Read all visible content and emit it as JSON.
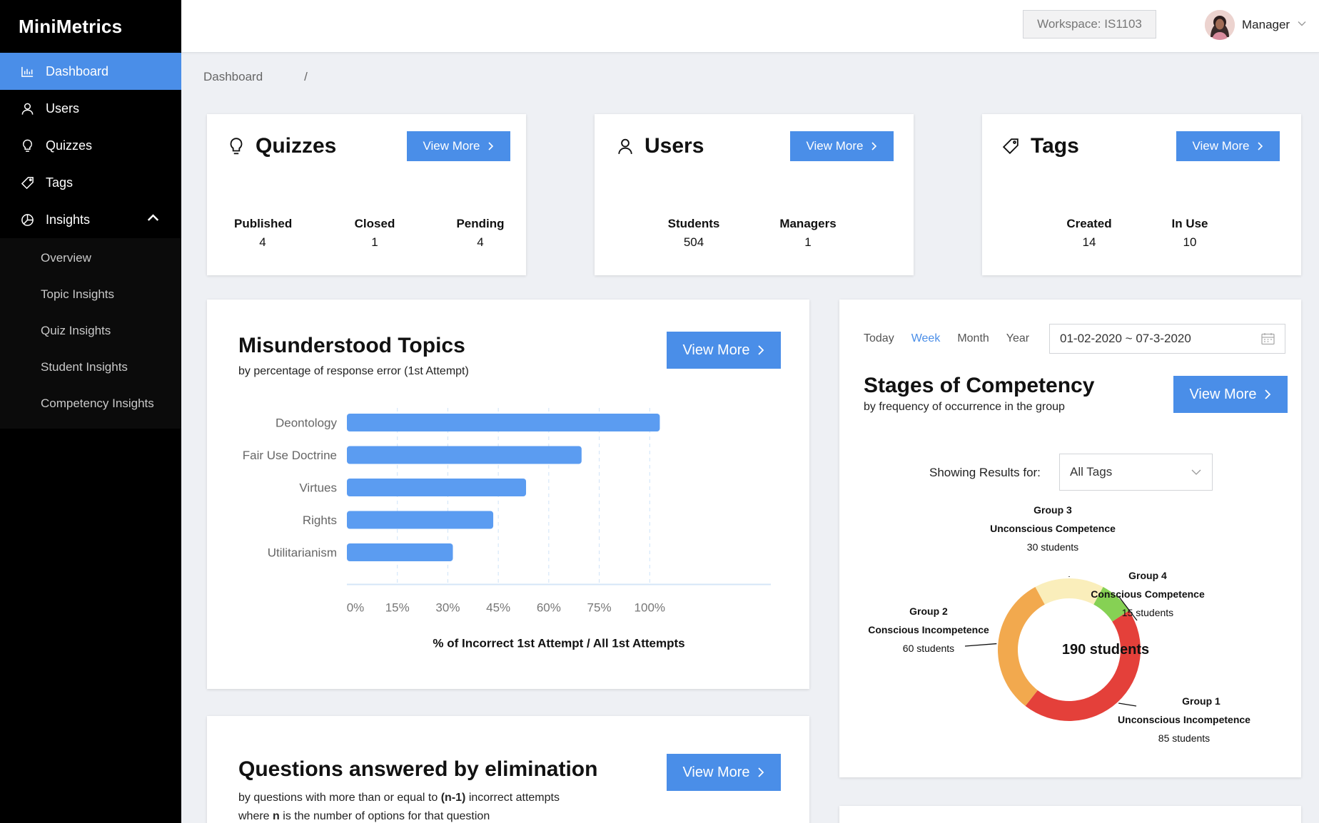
{
  "app": {
    "name": "MiniMetrics"
  },
  "sidebar": {
    "items": [
      {
        "label": "Dashboard",
        "icon": "bar-chart-icon",
        "active": true
      },
      {
        "label": "Users",
        "icon": "user-icon"
      },
      {
        "label": "Quizzes",
        "icon": "lightbulb-icon"
      },
      {
        "label": "Tags",
        "icon": "tag-icon"
      },
      {
        "label": "Insights",
        "icon": "pie-chart-icon",
        "expanded": true
      }
    ],
    "insights_sub": [
      "Overview",
      "Topic Insights",
      "Quiz Insights",
      "Student Insights",
      "Competency Insights"
    ]
  },
  "header": {
    "workspace": "Workspace: IS1103",
    "user_role": "Manager"
  },
  "breadcrumb": {
    "current": "Dashboard",
    "separator": "/"
  },
  "common": {
    "view_more": "View More"
  },
  "quizzes_card": {
    "title": "Quizzes",
    "stats": [
      {
        "label": "Published",
        "value": "4"
      },
      {
        "label": "Closed",
        "value": "1"
      },
      {
        "label": "Pending",
        "value": "4"
      }
    ]
  },
  "users_card": {
    "title": "Users",
    "stats": [
      {
        "label": "Students",
        "value": "504"
      },
      {
        "label": "Managers",
        "value": "1"
      }
    ]
  },
  "tags_card": {
    "title": "Tags",
    "stats": [
      {
        "label": "Created",
        "value": "14"
      },
      {
        "label": "In Use",
        "value": "10"
      }
    ]
  },
  "misunderstood": {
    "title": "Misunderstood Topics",
    "subtitle": "by percentage of response error (1st Attempt)"
  },
  "competency": {
    "range_tabs": [
      "Today",
      "Week",
      "Month",
      "Year"
    ],
    "active_range": "Week",
    "date_range": "01-02-2020 ~ 07-3-2020",
    "title": "Stages of Competency",
    "subtitle": "by frequency of occurrence in the group",
    "filter_label": "Showing Results for:",
    "filter_value": "All Tags",
    "center_label": "190 students"
  },
  "elimination": {
    "title": "Questions answered by elimination",
    "subtitle_pre": "by questions with more than or equal to ",
    "subtitle_bold": "(n-1)",
    "subtitle_post": " incorrect attempts",
    "subtitle2_pre": "where ",
    "subtitle2_bold": "n",
    "subtitle2_post": " is the number of options for that question"
  },
  "colors": {
    "accent": "#4a8ee8",
    "bar": "#5b9cf1",
    "group1": "#e4403a",
    "group2": "#f2a94e",
    "group3": "#faeebb",
    "group4": "#86d154"
  },
  "chart_data": [
    {
      "type": "bar",
      "orientation": "horizontal",
      "categories": [
        "Deontology",
        "Fair Use Doctrine",
        "Virtues",
        "Rights",
        "Utilitarianism"
      ],
      "values": [
        62,
        46.5,
        35.5,
        29,
        21
      ],
      "xticks": [
        "0%",
        "15%",
        "30%",
        "45%",
        "60%",
        "75%",
        "100%"
      ],
      "xtick_values": [
        0,
        10,
        20,
        30,
        40,
        50,
        60
      ],
      "xlabel": "% of Incorrect 1st Attempt / All 1st Attempts",
      "xlim": [
        0,
        84
      ],
      "grid": true
    },
    {
      "type": "pie",
      "donut": true,
      "slices": [
        {
          "group": "Group 3",
          "stage": "Unconscious Competence",
          "value": 30,
          "label": "30 students"
        },
        {
          "group": "Group 4",
          "stage": "Conscious Competence",
          "value": 15,
          "label": "15 students"
        },
        {
          "group": "Group 1",
          "stage": "Unconscious Incompetence",
          "value": 85,
          "label": "85 students"
        },
        {
          "group": "Group 2",
          "stage": "Conscious Incompetence",
          "value": 60,
          "label": "60 students"
        }
      ]
    }
  ]
}
